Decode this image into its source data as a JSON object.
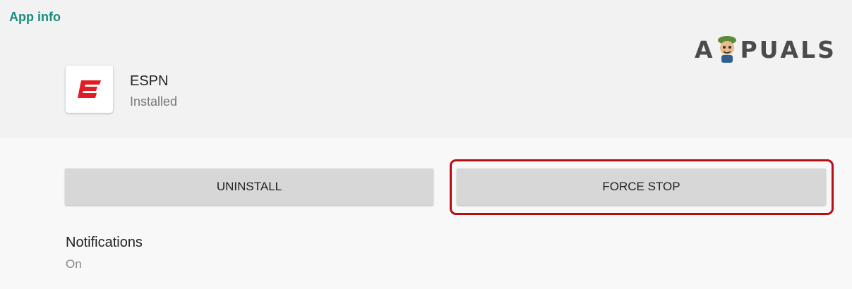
{
  "header": {
    "title": "App info"
  },
  "watermark": {
    "letters": [
      "A",
      "P",
      "U",
      "A",
      "L",
      "S"
    ]
  },
  "app": {
    "name": "ESPN",
    "status": "Installed",
    "icon": "espn-logo-icon"
  },
  "actions": {
    "uninstall_label": "UNINSTALL",
    "force_stop_label": "FORCE STOP"
  },
  "settings": {
    "notifications": {
      "title": "Notifications",
      "value": "On"
    }
  },
  "colors": {
    "accent": "#1a8c7e",
    "highlight": "#b80d12",
    "espn_red": "#e31b23",
    "button_bg": "#d7d7d7"
  }
}
